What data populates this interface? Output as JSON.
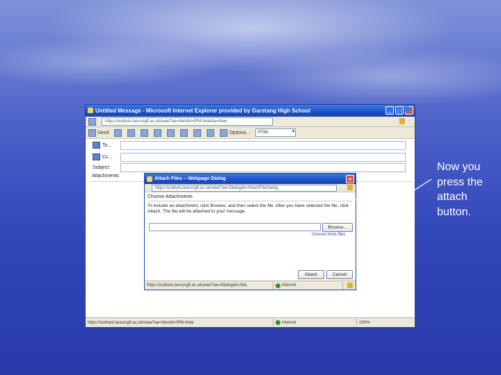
{
  "ie_window": {
    "title": "Untitled Message - Microsoft Internet Explorer provided by Garstang High School",
    "address": "https://outlook.lancsngfl.ac.uk/owa/?ae=Item&t=IPM.Note&a=New",
    "toolbar": {
      "send_label": "Send",
      "options_label": "Options...",
      "format_value": "HTML"
    },
    "fields": {
      "to_label": "To...",
      "cc_label": "Cc...",
      "subject_label": "Subject:"
    },
    "attachments_label": "Attachments",
    "status": {
      "url": "https://outlook.lancsngfl.ac.uk/owa/?ae=Item&t=IPM.Note",
      "zone": "Internet",
      "zoom": "100%"
    }
  },
  "dialog": {
    "title": "Attach Files -- Webpage Dialog",
    "address": "https://outlook.lancsngfl.ac.uk/owa/?ae=Dialog&t=AttachFileDialog",
    "heading": "Choose Attachments",
    "instructions": "To include an attachment, click Browse, and then select the file. After you have selected the file, click Attach. The file will be attached to your message.",
    "browse_label": "Browse...",
    "more_files_label": "Choose more files",
    "attach_label": "Attach",
    "cancel_label": "Cancel",
    "status_url": "https://outlook.lancsngfl.ac.uk/owa/?ae=Dialog&t=Atta",
    "status_zone": "Internet"
  },
  "annotation": {
    "text": "Now you press the attach button."
  },
  "colors": {
    "titlebar": "#1b4fc4",
    "chrome": "#ece9d8",
    "annotation_text": "#ffffff"
  }
}
